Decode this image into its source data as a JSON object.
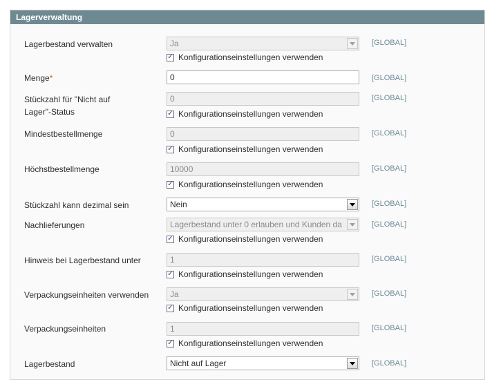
{
  "section": {
    "title": "Lagerverwaltung"
  },
  "config_label": "Konfigurationseinstellungen verwenden",
  "check_mark": "✓",
  "rows": [
    {
      "label": "Lagerbestand verwalten",
      "value": "Ja",
      "scope": "[GLOBAL]"
    },
    {
      "label": "Menge",
      "required_mark": "*",
      "value": "0",
      "scope": "[GLOBAL]"
    },
    {
      "label": "Stückzahl für \"Nicht auf Lager\"-Status",
      "value": "0",
      "scope": "[GLOBAL]"
    },
    {
      "label": "Mindestbestellmenge",
      "value": "0",
      "scope": "[GLOBAL]"
    },
    {
      "label": "Höchstbestellmenge",
      "value": "10000",
      "scope": "[GLOBAL]"
    },
    {
      "label": "Stückzahl kann dezimal sein",
      "value": "Nein",
      "scope": "[GLOBAL]"
    },
    {
      "label": "Nachlieferungen",
      "value": "Lagerbestand unter 0 erlauben und Kunden da",
      "scope": "[GLOBAL]"
    },
    {
      "label": "Hinweis bei Lagerbestand unter",
      "value": "1",
      "scope": "[GLOBAL]"
    },
    {
      "label": "Verpackungseinheiten verwenden",
      "value": "Ja",
      "scope": "[GLOBAL]"
    },
    {
      "label": "Verpackungseinheiten",
      "value": "1",
      "scope": "[GLOBAL]"
    },
    {
      "label": "Lagerbestand",
      "value": "Nicht auf Lager",
      "scope": "[GLOBAL]"
    }
  ]
}
